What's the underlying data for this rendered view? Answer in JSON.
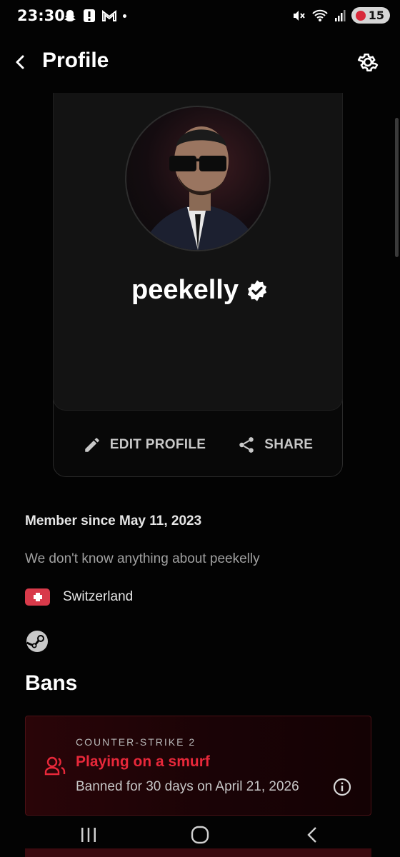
{
  "status_bar": {
    "time": "23:30",
    "battery": "15",
    "left_icons": [
      "snapchat-icon",
      "alert-icon",
      "gmail-icon",
      "dot-icon"
    ],
    "right_icons": [
      "mute-icon",
      "wifi-icon",
      "signal-icon",
      "battery-icon"
    ]
  },
  "header": {
    "title": "Profile"
  },
  "profile": {
    "username": "peekelly",
    "verified": true,
    "actions": {
      "edit_label": "EDIT PROFILE",
      "share_label": "SHARE"
    },
    "member_since": "Member since May 11, 2023",
    "bio": "We don't know anything about peekelly",
    "country": "Switzerland"
  },
  "bans": {
    "heading": "Bans",
    "items": [
      {
        "game": "COUNTER-STRIKE 2",
        "reason": "Playing on a smurf",
        "detail": "Banned for 30 days on April 21, 2026"
      }
    ]
  },
  "colors": {
    "background": "#030303",
    "card": "#131313",
    "accent_red": "#e8283a",
    "flag_red": "#d83a4a",
    "ban_bg": "#2a0508"
  }
}
